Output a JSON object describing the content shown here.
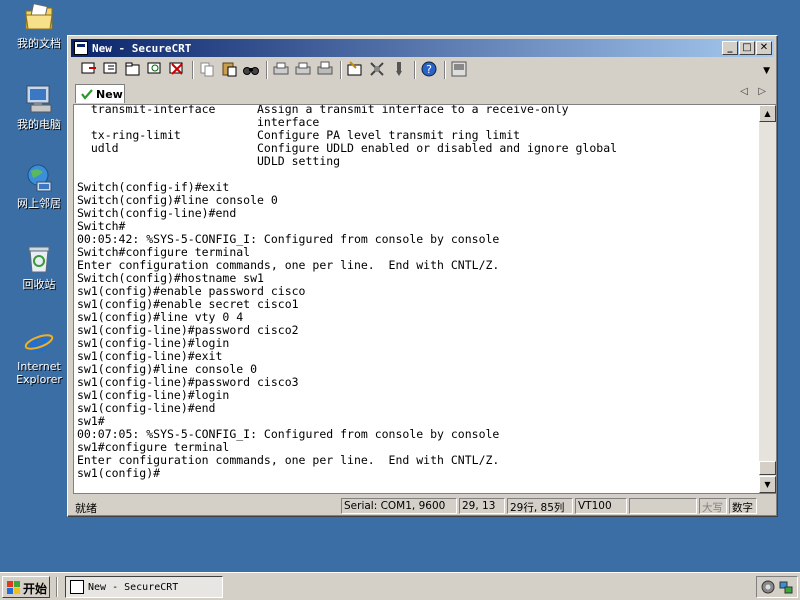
{
  "desktop": {
    "icons": [
      {
        "label": "我的文档",
        "icon": "my-documents-icon"
      },
      {
        "label": "我的电脑",
        "icon": "my-computer-icon"
      },
      {
        "label": "网上邻居",
        "icon": "network-places-icon"
      },
      {
        "label": "回收站",
        "icon": "recycle-bin-icon"
      },
      {
        "label": "Internet Explorer",
        "icon": "internet-explorer-icon"
      }
    ]
  },
  "window": {
    "title": "New - SecureCRT",
    "tab_label": "New"
  },
  "terminal": {
    "lines": [
      "  transmit-interface      Assign a transmit interface to a receive-only",
      "                          interface",
      "  tx-ring-limit           Configure PA level transmit ring limit",
      "  udld                    Configure UDLD enabled or disabled and ignore global",
      "                          UDLD setting",
      "",
      "Switch(config-if)#exit",
      "Switch(config)#line console 0",
      "Switch(config-line)#end",
      "Switch#",
      "00:05:42: %SYS-5-CONFIG_I: Configured from console by console",
      "Switch#configure terminal",
      "Enter configuration commands, one per line.  End with CNTL/Z.",
      "Switch(config)#hostname sw1",
      "sw1(config)#enable password cisco",
      "sw1(config)#enable secret cisco1",
      "sw1(config)#line vty 0 4",
      "sw1(config-line)#password cisco2",
      "sw1(config-line)#login",
      "sw1(config-line)#exit",
      "sw1(config)#line console 0",
      "sw1(config-line)#password cisco3",
      "sw1(config-line)#login",
      "sw1(config-line)#end",
      "sw1#",
      "00:07:05: %SYS-5-CONFIG_I: Configured from console by console",
      "sw1#configure terminal",
      "Enter configuration commands, one per line.  End with CNTL/Z.",
      "sw1(config)#"
    ]
  },
  "status": {
    "ready": "就绪",
    "connection": "Serial: COM1, 9600",
    "cursor": "29, 13",
    "rows_cols": "29行, 85列",
    "emulation": "VT100",
    "caps": "大写",
    "num": "数字"
  },
  "taskbar": {
    "start_label": "开始",
    "task_label": "New - SecureCRT"
  }
}
